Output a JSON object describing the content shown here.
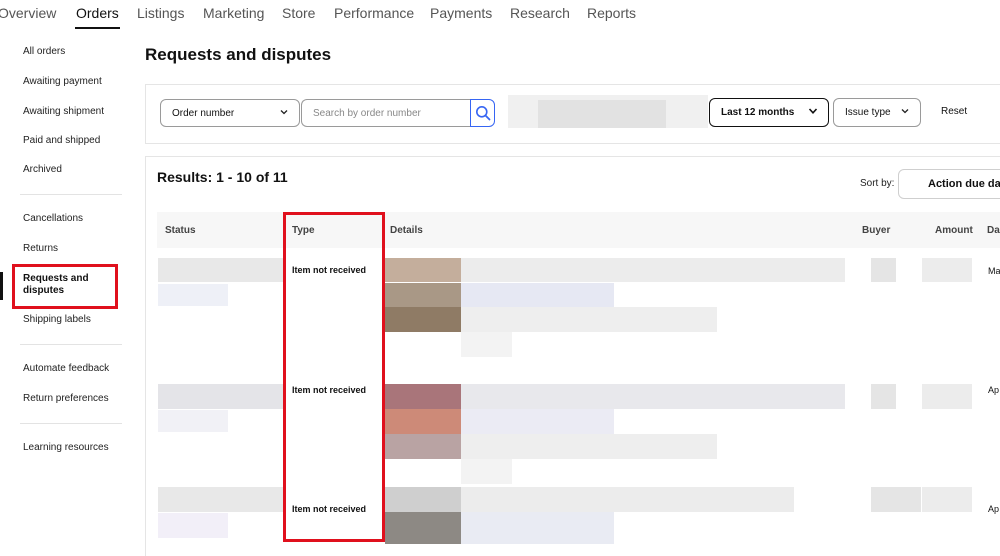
{
  "topnav": {
    "tabs": [
      {
        "label": "Overview",
        "active": false
      },
      {
        "label": "Orders",
        "active": true
      },
      {
        "label": "Listings",
        "active": false
      },
      {
        "label": "Marketing",
        "active": false
      },
      {
        "label": "Store",
        "active": false
      },
      {
        "label": "Performance",
        "active": false
      },
      {
        "label": "Payments",
        "active": false
      },
      {
        "label": "Research",
        "active": false
      },
      {
        "label": "Reports",
        "active": false
      }
    ]
  },
  "sidebar": {
    "items": [
      {
        "label": "All orders"
      },
      {
        "label": "Awaiting payment"
      },
      {
        "label": "Awaiting shipment"
      },
      {
        "label": "Paid and shipped"
      },
      {
        "label": "Archived"
      },
      {
        "label": "Cancellations"
      },
      {
        "label": "Returns"
      },
      {
        "label": "Requests and disputes",
        "active": true
      },
      {
        "label": "Shipping labels"
      },
      {
        "label": "Automate feedback"
      },
      {
        "label": "Return preferences"
      },
      {
        "label": "Learning resources"
      }
    ]
  },
  "page": {
    "title": "Requests and disputes"
  },
  "filters": {
    "search_field_select": "Order number",
    "search_placeholder": "Search by order number",
    "date_range": "Last 12 months",
    "issue_type": "Issue type",
    "reset_label": "Reset"
  },
  "results": {
    "summary": "Results: 1 - 10 of 11",
    "sort_label": "Sort by:",
    "sort_value": "Action due da",
    "columns": {
      "status": "Status",
      "type": "Type",
      "details": "Details",
      "buyer": "Buyer",
      "amount": "Amount",
      "date": "Da"
    },
    "rows": [
      {
        "type": "Item not received",
        "date": "Ma"
      },
      {
        "type": "Item not received",
        "date": "Ap"
      },
      {
        "type": "Item not received",
        "date": "Ap"
      }
    ]
  },
  "colors": {
    "highlight": "#e0101d",
    "link_blue": "#3665f3",
    "text": "#111111"
  }
}
